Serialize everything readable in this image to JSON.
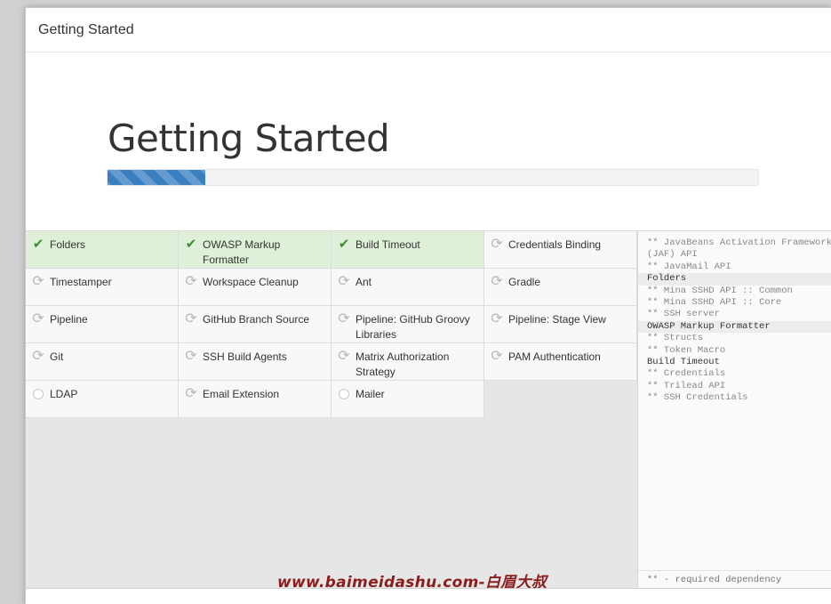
{
  "dialog": {
    "title": "Getting Started"
  },
  "hero": {
    "title": "Getting Started",
    "progress_fraction": 0.15
  },
  "plugins": [
    {
      "name": "Folders",
      "status": "success"
    },
    {
      "name": "OWASP Markup Formatter",
      "status": "success"
    },
    {
      "name": "Build Timeout",
      "status": "success"
    },
    {
      "name": "Credentials Binding",
      "status": "pending"
    },
    {
      "name": "Timestamper",
      "status": "pending"
    },
    {
      "name": "Workspace Cleanup",
      "status": "pending"
    },
    {
      "name": "Ant",
      "status": "pending"
    },
    {
      "name": "Gradle",
      "status": "pending"
    },
    {
      "name": "Pipeline",
      "status": "pending"
    },
    {
      "name": "GitHub Branch Source",
      "status": "pending"
    },
    {
      "name": "Pipeline: GitHub Groovy Libraries",
      "status": "pending"
    },
    {
      "name": "Pipeline: Stage View",
      "status": "pending"
    },
    {
      "name": "Git",
      "status": "pending"
    },
    {
      "name": "SSH Build Agents",
      "status": "pending"
    },
    {
      "name": "Matrix Authorization Strategy",
      "status": "pending"
    },
    {
      "name": "PAM Authentication",
      "status": "pending"
    },
    {
      "name": "LDAP",
      "status": "queued"
    },
    {
      "name": "Email Extension",
      "status": "pending"
    },
    {
      "name": "Mailer",
      "status": "queued"
    }
  ],
  "log": {
    "lines": [
      {
        "text": "** JavaBeans Activation Framework",
        "kind": "dep"
      },
      {
        "text": "(JAF) API",
        "kind": "dep"
      },
      {
        "text": "** JavaMail API",
        "kind": "dep"
      },
      {
        "text": "Folders",
        "kind": "hl"
      },
      {
        "text": "** Mina SSHD API :: Common",
        "kind": "dep"
      },
      {
        "text": "** Mina SSHD API :: Core",
        "kind": "dep"
      },
      {
        "text": "** SSH server",
        "kind": "dep"
      },
      {
        "text": "OWASP Markup Formatter",
        "kind": "hl"
      },
      {
        "text": "** Structs",
        "kind": "dep"
      },
      {
        "text": "** Token Macro",
        "kind": "dep"
      },
      {
        "text": "Build Timeout",
        "kind": "plain"
      },
      {
        "text": "** Credentials",
        "kind": "dep"
      },
      {
        "text": "** Trilead API",
        "kind": "dep"
      },
      {
        "text": "** SSH Credentials",
        "kind": "dep"
      }
    ],
    "footer": "** - required dependency"
  },
  "watermark": "www.baimeidashu.com-白眉大叔",
  "icons": {
    "success": "check-icon",
    "pending": "refresh-icon",
    "queued": "circle-icon"
  },
  "colors": {
    "success_bg": "#dff0d8",
    "check": "#3c8d2f",
    "progress": "#3a7fc0",
    "watermark": "#8c1d1d"
  }
}
